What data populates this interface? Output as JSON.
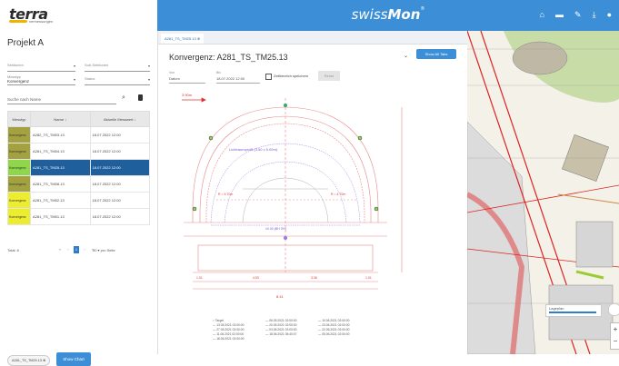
{
  "header": {
    "logo": "terra",
    "logo_sub": "vermessungen",
    "brand_light": "swiss",
    "brand_bold": "Mon",
    "brand_reg": "®",
    "icons": [
      "home-icon",
      "folder-icon",
      "wrench-icon",
      "download-icon",
      "help-icon"
    ]
  },
  "left": {
    "project_title": "Projekt A",
    "filters": [
      {
        "label": "Sektionen",
        "value": ""
      },
      {
        "label": "Sub-Sektionen",
        "value": ""
      },
      {
        "label": "Messtyp",
        "value": "Konvergenz"
      },
      {
        "label": "Status",
        "value": ""
      }
    ],
    "search_placeholder": "Suche nach Name",
    "columns": [
      "Messtyp",
      "Name ↓",
      "Aktuelle Messwert ↓"
    ],
    "rows": [
      {
        "status": "Konvergenz",
        "name": "A282_TS_TM03.13",
        "date": "18.07.2022 12:00",
        "color": "#a4a240"
      },
      {
        "status": "Konvergenz",
        "name": "A281_TS_TM04.13",
        "date": "18.07.2022 12:00",
        "color": "#a4a240"
      },
      {
        "status": "Konvergenz",
        "name": "A281_TS_TM25.13",
        "date": "18.07.2022 12:00",
        "color": "#8fd64a"
      },
      {
        "status": "Konvergenz",
        "name": "A281_TS_TM08.13",
        "date": "18.07.2022 12:00",
        "color": "#a4a240"
      },
      {
        "status": "Konvergenz",
        "name": "A281_TS_TM02.13",
        "date": "18.07.2022 12:00",
        "color": "#ecec30"
      },
      {
        "status": "Konvergenz",
        "name": "A281_TS_TM01.13",
        "date": "18.07.2022 12:00",
        "color": "#ecec30"
      }
    ],
    "selected_row": 2,
    "total": "Total: 6",
    "pages": [
      "«",
      "‹",
      "1",
      "›",
      "»"
    ],
    "per_page": "50 ▾ pro Seite",
    "chip": "A281_TS_TM25.13",
    "show_chart": "Show Chart"
  },
  "middle": {
    "tab": "A281_TS_TM25.13",
    "title": "Konvergenz: A281_TS_TM25.13",
    "zoom_fit": "Show All Tabs",
    "from_label": "Von",
    "from_placeholder": "Datum",
    "to_label": "Bis",
    "to_value": "18.07.2022 12:00",
    "checkbox_label": "Zeitbereich speichern",
    "reset": "Reset",
    "drawing_labels": {
      "top_dim": "3.90m",
      "profile": "Lichtraumprofil (3.50 x 5.00m)",
      "center": "±0.00 (BH 3%)",
      "bottom_dim": "8.41",
      "left_h": "R = 5.70m",
      "right_h": "R = 4.70m",
      "dims": [
        "1.01",
        "4.53",
        "3.36",
        "1.01"
      ]
    },
    "legend": [
      "Target",
      "13.05.2021 02:00:00",
      "27.05.2021 02:00:00",
      "11.06.2021 02:00:00",
      "18.06.2021 02:00:00",
      "06.05.2021 02:00:00",
      "20.05.2021 02:00:00",
      "03.06.2021 02:00:00",
      "18.06.2021 05:40:07",
      "10.06.2021 02:00:00",
      "23.06.2021 02:00:00",
      "22.06.2021 02:00:00",
      "05.06.2021 02:00:00"
    ]
  },
  "map": {
    "layer_label": "Lageplan"
  }
}
